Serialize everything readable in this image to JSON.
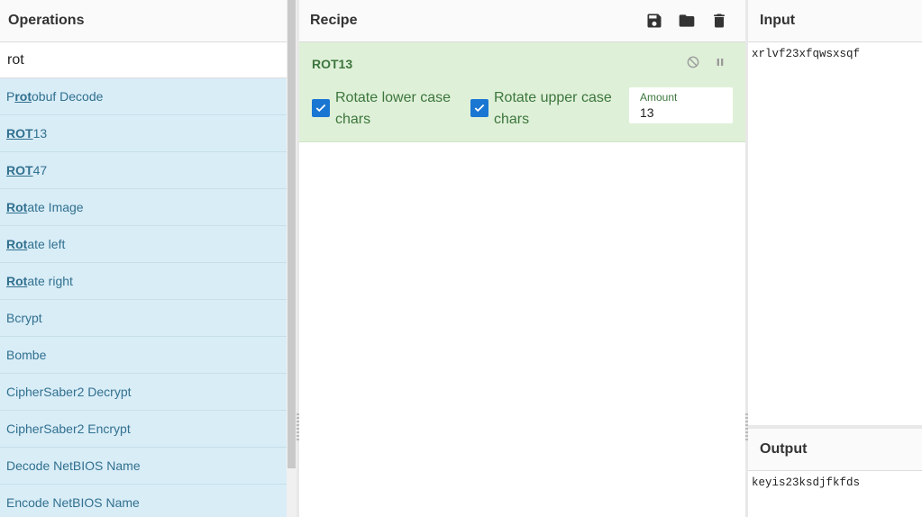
{
  "operations": {
    "title": "Operations",
    "search_value": "rot",
    "items": [
      {
        "pre": "P",
        "match": "rot",
        "post": "obuf Decode"
      },
      {
        "pre": "",
        "match": "ROT",
        "post": "13"
      },
      {
        "pre": "",
        "match": "ROT",
        "post": "47"
      },
      {
        "pre": "",
        "match": "Rot",
        "post": "ate Image"
      },
      {
        "pre": "",
        "match": "Rot",
        "post": "ate left"
      },
      {
        "pre": "",
        "match": "Rot",
        "post": "ate right"
      },
      {
        "pre": "Bcrypt",
        "match": "",
        "post": ""
      },
      {
        "pre": "Bombe",
        "match": "",
        "post": ""
      },
      {
        "pre": "CipherSaber2 Decrypt",
        "match": "",
        "post": ""
      },
      {
        "pre": "CipherSaber2 Encrypt",
        "match": "",
        "post": ""
      },
      {
        "pre": "Decode NetBIOS Name",
        "match": "",
        "post": ""
      },
      {
        "pre": "Encode NetBIOS Name",
        "match": "",
        "post": ""
      }
    ]
  },
  "recipe": {
    "title": "Recipe",
    "tools": [
      "save-icon",
      "folder-icon",
      "trash-icon"
    ],
    "operation": {
      "name": "ROT13",
      "rotate_lower_label": "Rotate lower case chars",
      "rotate_lower_checked": true,
      "rotate_upper_label": "Rotate upper case chars",
      "rotate_upper_checked": true,
      "amount_label": "Amount",
      "amount_value": "13"
    }
  },
  "input": {
    "title": "Input",
    "value": "xrlvf23xfqwsxsqf"
  },
  "output": {
    "title": "Output",
    "value": "keyis23ksdjfkfds"
  },
  "colors": {
    "op_item_bg": "#d9edf7",
    "op_item_text": "#31708f",
    "recipe_card_bg": "#dff0d8",
    "recipe_card_text": "#3c763d",
    "checkbox": "#1976d2"
  }
}
